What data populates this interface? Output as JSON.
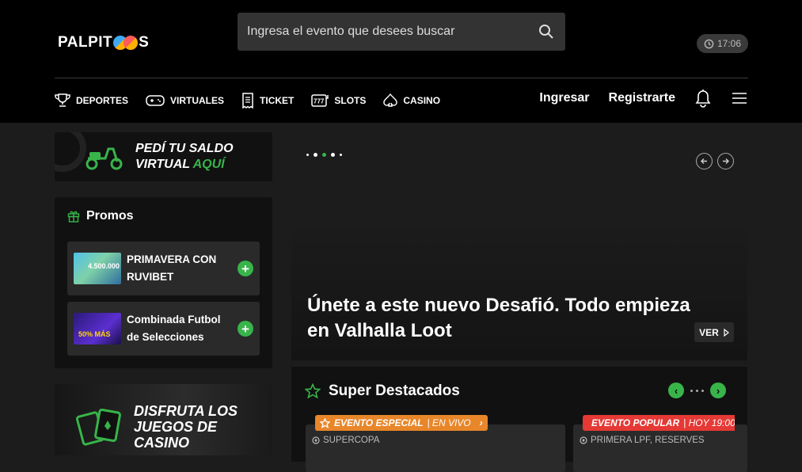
{
  "header": {
    "logo_text_a": "PALPIT",
    "logo_text_b": "S",
    "search_placeholder": "Ingresa el evento que desees buscar",
    "clock": "17:06"
  },
  "nav": {
    "items": [
      {
        "label": "DEPORTES",
        "icon": "trophy-icon"
      },
      {
        "label": "VIRTUALES",
        "icon": "gamepad-icon"
      },
      {
        "label": "TICKET",
        "icon": "ticket-icon"
      },
      {
        "label": "SLOTS",
        "icon": "slot-machine-icon"
      },
      {
        "label": "CASINO",
        "icon": "spade-icon"
      }
    ],
    "login": "Ingresar",
    "register": "Registrarte"
  },
  "sidebar": {
    "saldo_line1": "PEDÍ TU SALDO",
    "saldo_line2a": "VIRTUAL ",
    "saldo_line2b": "AQUÍ",
    "promos_title": "Promos",
    "promos": [
      {
        "label": "PRIMAVERA CON RUVIBET",
        "thumb_text": "4.500.000"
      },
      {
        "label": "Combinada Futbol de Selecciones",
        "thumb_text": "50% MÁS"
      }
    ],
    "casino_text": "DISFRUTA LOS JUEGOS DE CASINO"
  },
  "hero": {
    "title": "Únete a este nuevo Desafió. Todo empieza en Valhalla Loot",
    "ver": "VER"
  },
  "destacados": {
    "title": "Super Destacados",
    "cards": [
      {
        "badge_main": "EVENTO ESPECIAL",
        "badge_sub": "| EN VIVO",
        "league": "SUPERCOPA",
        "color": "#e8862a"
      },
      {
        "badge_main": "EVENTO POPULAR",
        "badge_sub": "| HOY 19:00",
        "league": "PRIMERA LPF, RESERVES",
        "color": "#e53935"
      }
    ]
  },
  "colors": {
    "accent": "#38b44a",
    "header_bg": "#000000",
    "page_bg": "#1c1c1c"
  }
}
